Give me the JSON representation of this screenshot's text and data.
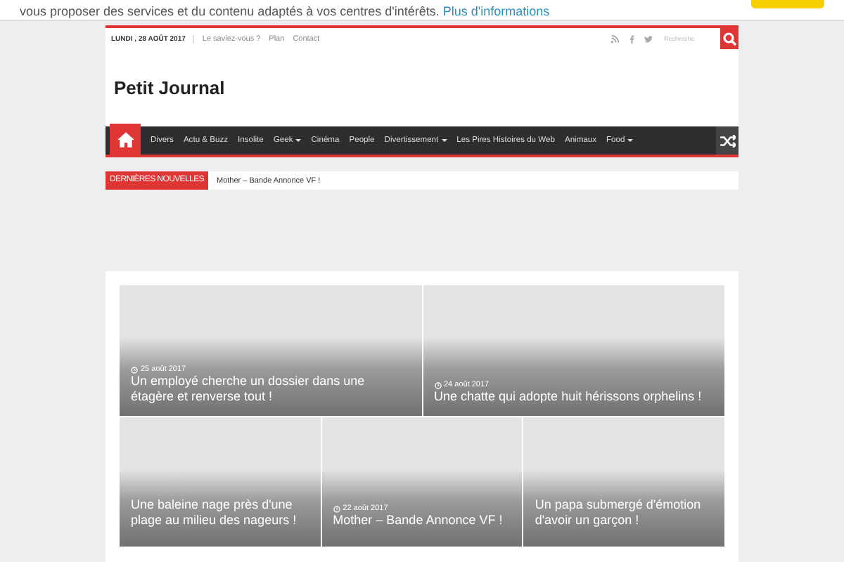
{
  "cookie_banner": {
    "text": "vous proposer des services et du contenu adaptés à vos centres d'intérêts.",
    "link": "Plus d'informations"
  },
  "top_bar": {
    "date": "LUNDI , 28 AOÛT 2017",
    "links": [
      "Le saviez-vous ?",
      "Plan",
      "Contact"
    ],
    "search": {
      "placeholder": "Recherche"
    }
  },
  "logo": {
    "text": "Petit Journal"
  },
  "nav": {
    "items": [
      {
        "label": "Divers",
        "dropdown": false
      },
      {
        "label": "Actu & Buzz",
        "dropdown": false
      },
      {
        "label": "Insolite",
        "dropdown": false
      },
      {
        "label": "Geek",
        "dropdown": true
      },
      {
        "label": "Cinéma",
        "dropdown": false
      },
      {
        "label": "People",
        "dropdown": false
      },
      {
        "label": "Divertissement",
        "dropdown": true
      },
      {
        "label": "Les Pires Histoires du Web",
        "dropdown": false
      },
      {
        "label": "Animaux",
        "dropdown": false
      },
      {
        "label": "Food",
        "dropdown": true
      }
    ]
  },
  "ticker": {
    "label": "DERNIÈRES NOUVELLES",
    "headline": "Mother – Bande Annonce VF !"
  },
  "featured": [
    {
      "date": "25 août 2017",
      "title": "Un employé cherche un dossier dans une étagère et renverse tout !"
    },
    {
      "date": "24 août 2017",
      "title": "Une chatte qui adopte huit hérissons orphelins !"
    }
  ],
  "featured_small": [
    {
      "title": "Une baleine nage près d'une plage au milieu des nageurs !"
    },
    {
      "date": "22 août 2017",
      "title": "Mother – Bande Annonce VF !"
    },
    {
      "title": "Un papa submergé d'émotion d'avoir un garçon !"
    }
  ]
}
